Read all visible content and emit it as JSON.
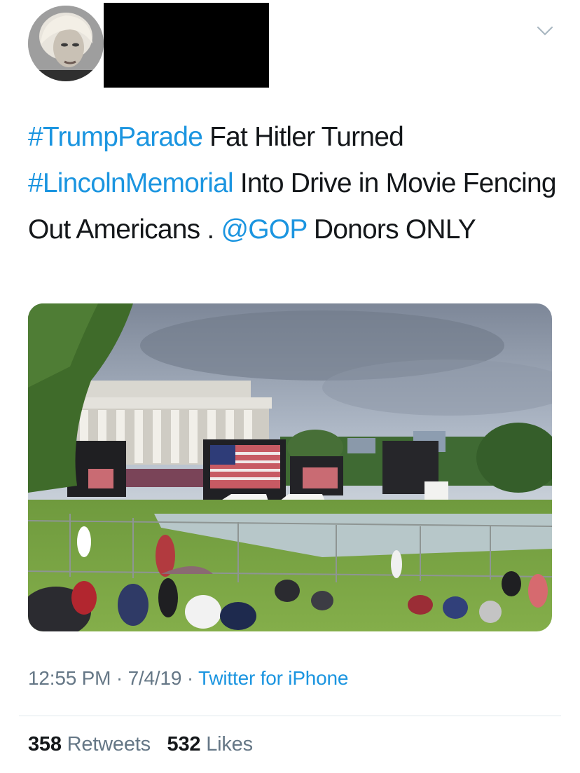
{
  "tweet": {
    "author": {
      "avatar": "profile-photo",
      "name_redacted": true
    },
    "text_segments": [
      {
        "text": "#TrumpParade",
        "type": "hashtag"
      },
      {
        "text": " Fat Hitler Turned ",
        "type": "text"
      },
      {
        "text": "#LincolnMemorial",
        "type": "hashtag"
      },
      {
        "text": " Into Drive in Movie Fencing Out Americans . ",
        "type": "text"
      },
      {
        "text": "@GOP",
        "type": "mention"
      },
      {
        "text": " Donors ONLY",
        "type": "text"
      }
    ],
    "media": {
      "type": "photo"
    },
    "time": "12:55 PM",
    "date": "7/4/19",
    "source": "Twitter for iPhone",
    "separator": "·",
    "retweets_count": "358",
    "retweets_label": "Retweets",
    "likes_count": "532",
    "likes_label": "Likes"
  },
  "colors": {
    "link": "#1b95e0",
    "text": "#14171a",
    "secondary": "#657786",
    "divider": "#e1e8ed"
  },
  "icons": {
    "menu": "chevron-down-icon"
  }
}
